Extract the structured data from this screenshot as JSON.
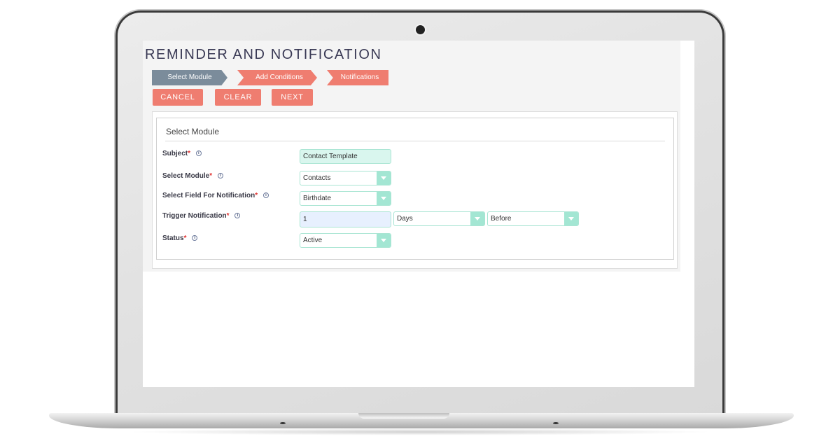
{
  "page": {
    "title": "REMINDER AND NOTIFICATION"
  },
  "steps": [
    {
      "label": "Select Module",
      "state": "active"
    },
    {
      "label": "Add Conditions",
      "state": "inactive"
    },
    {
      "label": "Notifications",
      "state": "inactive"
    }
  ],
  "toolbar": {
    "cancel_label": "CANCEL",
    "clear_label": "CLEAR",
    "next_label": "NEXT"
  },
  "panel": {
    "title": "Select Module",
    "fields": {
      "subject": {
        "label": "Subject",
        "required_mark": "*",
        "value": "Contact Template"
      },
      "module": {
        "label": "Select Module",
        "required_mark": "*",
        "value": "Contacts"
      },
      "notify_field": {
        "label": "Select Field For Notification",
        "required_mark": "*",
        "value": "Birthdate"
      },
      "trigger": {
        "label": "Trigger Notification",
        "required_mark": "*",
        "value": "1",
        "unit": "Days",
        "direction": "Before"
      },
      "status": {
        "label": "Status",
        "required_mark": "*",
        "value": "Active"
      }
    }
  },
  "icons": {
    "info": "i"
  },
  "colors": {
    "accent": "#ef7d70",
    "step_active": "#7b8c9b",
    "field_border": "#a9e5d3",
    "select_arrow": "#a3e6d3",
    "required": "#e0302e"
  }
}
